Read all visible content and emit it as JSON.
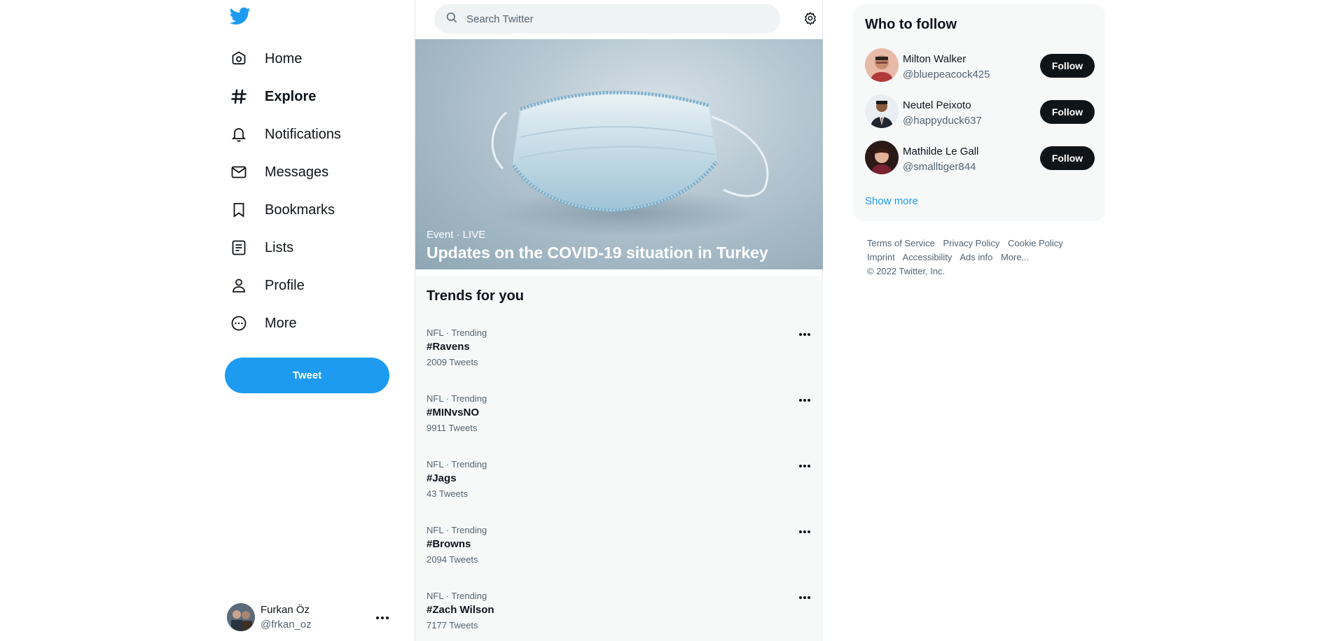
{
  "colors": {
    "brand": "#1d9bf0",
    "text": "#0f1419",
    "muted": "#536471"
  },
  "nav": {
    "items": [
      {
        "label": "Home",
        "icon": "home-icon"
      },
      {
        "label": "Explore",
        "icon": "hashtag-icon",
        "active": true
      },
      {
        "label": "Notifications",
        "icon": "bell-icon"
      },
      {
        "label": "Messages",
        "icon": "envelope-icon"
      },
      {
        "label": "Bookmarks",
        "icon": "bookmark-icon"
      },
      {
        "label": "Lists",
        "icon": "list-icon"
      },
      {
        "label": "Profile",
        "icon": "person-icon"
      },
      {
        "label": "More",
        "icon": "more-circle-icon"
      }
    ],
    "tweet_label": "Tweet"
  },
  "account": {
    "name": "Furkan Öz",
    "handle": "@frkan_oz"
  },
  "search": {
    "placeholder": "Search Twitter"
  },
  "hero": {
    "kicker": "Event · LIVE",
    "title": "Updates on the COVID-19 situation in Turkey"
  },
  "trends": {
    "title": "Trends for you",
    "items": [
      {
        "meta": "NFL · Trending",
        "name": "#Ravens",
        "count": "2009 Tweets"
      },
      {
        "meta": "NFL · Trending",
        "name": "#MINvsNO",
        "count": "9911 Tweets"
      },
      {
        "meta": "NFL · Trending",
        "name": "#Jags",
        "count": "43 Tweets"
      },
      {
        "meta": "NFL · Trending",
        "name": "#Browns",
        "count": "2094 Tweets"
      },
      {
        "meta": "NFL · Trending",
        "name": "#Zach Wilson",
        "count": "7177 Tweets"
      }
    ]
  },
  "who_to_follow": {
    "title": "Who to follow",
    "people": [
      {
        "name": "Milton Walker",
        "handle": "@bluepeacock425",
        "button": "Follow"
      },
      {
        "name": "Neutel Peixoto",
        "handle": "@happyduck637",
        "button": "Follow"
      },
      {
        "name": "Mathilde Le Gall",
        "handle": "@smalltiger844",
        "button": "Follow"
      }
    ],
    "show_more": "Show more"
  },
  "footer": {
    "links_row1": [
      "Terms of Service",
      "Privacy Policy",
      "Cookie Policy"
    ],
    "links_row2": [
      "Imprint",
      "Accessibility",
      "Ads info",
      "More..."
    ],
    "copyright": "© 2022 Twitter, Inc."
  }
}
